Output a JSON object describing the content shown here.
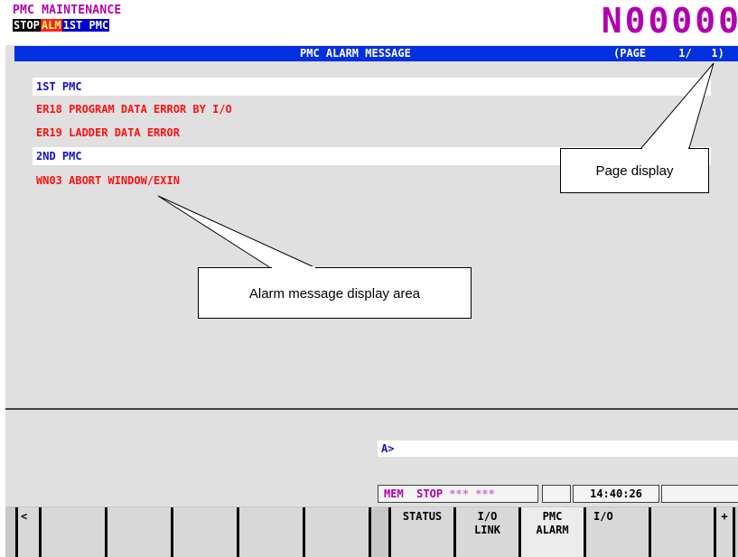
{
  "header": {
    "mode_title": "PMC MAINTENANCE",
    "status": {
      "stop": "STOP",
      "alm": "ALM",
      "path": "1ST PMC"
    },
    "program_number": "N00000"
  },
  "title_bar": {
    "title": "PMC ALARM MESSAGE",
    "page": "(PAGE     1/   1)"
  },
  "alarms": [
    {
      "kind": "section",
      "text": "1ST PMC"
    },
    {
      "kind": "message",
      "text": "ER18 PROGRAM DATA ERROR BY I/O"
    },
    {
      "kind": "message",
      "text": "ER19 LADDER DATA ERROR"
    },
    {
      "kind": "section",
      "text": "2ND PMC"
    },
    {
      "kind": "message",
      "text": "WN03 ABORT WINDOW/EXIN"
    }
  ],
  "callouts": {
    "page_display": "Page display",
    "alarm_area": "Alarm message display area"
  },
  "input": {
    "prompt": "A>"
  },
  "state": {
    "mode": "MEM",
    "run": "STOP",
    "stars1": "***",
    "stars2": "***",
    "time": "14:40:26"
  },
  "softkeys": {
    "left_arrow": "<",
    "status": "STATUS",
    "io_link": "I/O\nLINK",
    "pmc_alarm": "PMC\nALARM",
    "io": "I/O",
    "next": "+"
  },
  "colors": {
    "title_bar": "#0030e0",
    "alarm_text": "#ff1010",
    "section_text": "#1010d0",
    "mode_magenta": "#b000b0"
  }
}
